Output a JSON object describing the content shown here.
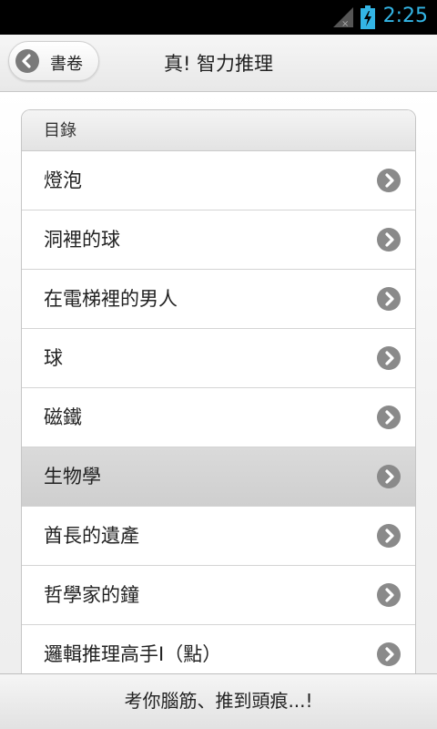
{
  "status_bar": {
    "time": "2:25",
    "icons": [
      "signal-icon",
      "battery-charging-icon"
    ],
    "accent_color": "#33b5e5"
  },
  "header": {
    "back_label": "書卷",
    "title": "真! 智力推理"
  },
  "toc": {
    "heading": "目錄",
    "items": [
      {
        "label": "燈泡"
      },
      {
        "label": "洞裡的球"
      },
      {
        "label": "在電梯裡的男人"
      },
      {
        "label": "球"
      },
      {
        "label": "磁鐵"
      },
      {
        "label": "生物學",
        "selected": true
      },
      {
        "label": "酋長的遺產"
      },
      {
        "label": "哲學家的鐘"
      },
      {
        "label": "邏輯推理高手I（點）"
      }
    ]
  },
  "footer": {
    "text": "考你腦筋、推到頭痕...!"
  }
}
